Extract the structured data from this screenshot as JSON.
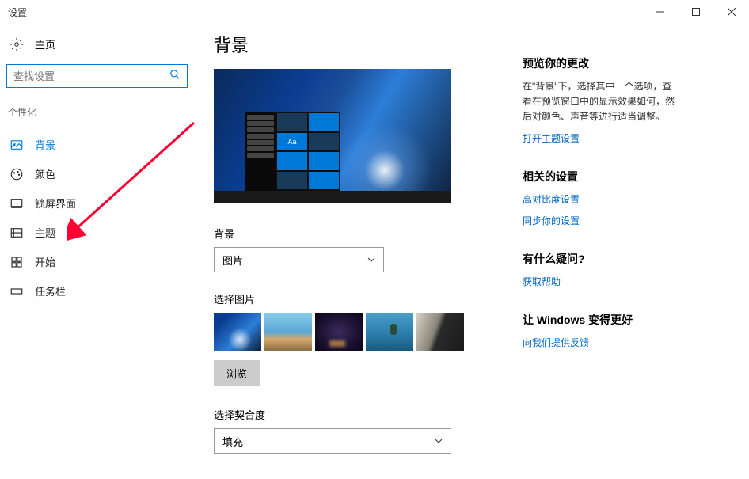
{
  "window_title": "设置",
  "home_label": "主页",
  "search_placeholder": "查找设置",
  "section_label": "个性化",
  "nav": {
    "background": "背景",
    "colors": "颜色",
    "lock": "锁屏界面",
    "themes": "主题",
    "start": "开始",
    "taskbar": "任务栏"
  },
  "page_title": "背景",
  "preview_tile_text": "Aa",
  "bg_label": "背景",
  "bg_dropdown": "图片",
  "choose_label": "选择图片",
  "browse_label": "浏览",
  "fit_label": "选择契合度",
  "fit_dropdown": "填充",
  "aside": {
    "preview": {
      "title": "预览你的更改",
      "text": "在\"背景\"下，选择其中一个选项，查看在预览窗口中的显示效果如何，然后对颜色、声音等进行适当调整。",
      "link": "打开主题设置"
    },
    "related": {
      "title": "相关的设置",
      "link1": "高对比度设置",
      "link2": "同步你的设置"
    },
    "help": {
      "title": "有什么疑问?",
      "link": "获取帮助"
    },
    "feedback": {
      "title": "让 Windows 变得更好",
      "link": "向我们提供反馈"
    }
  }
}
